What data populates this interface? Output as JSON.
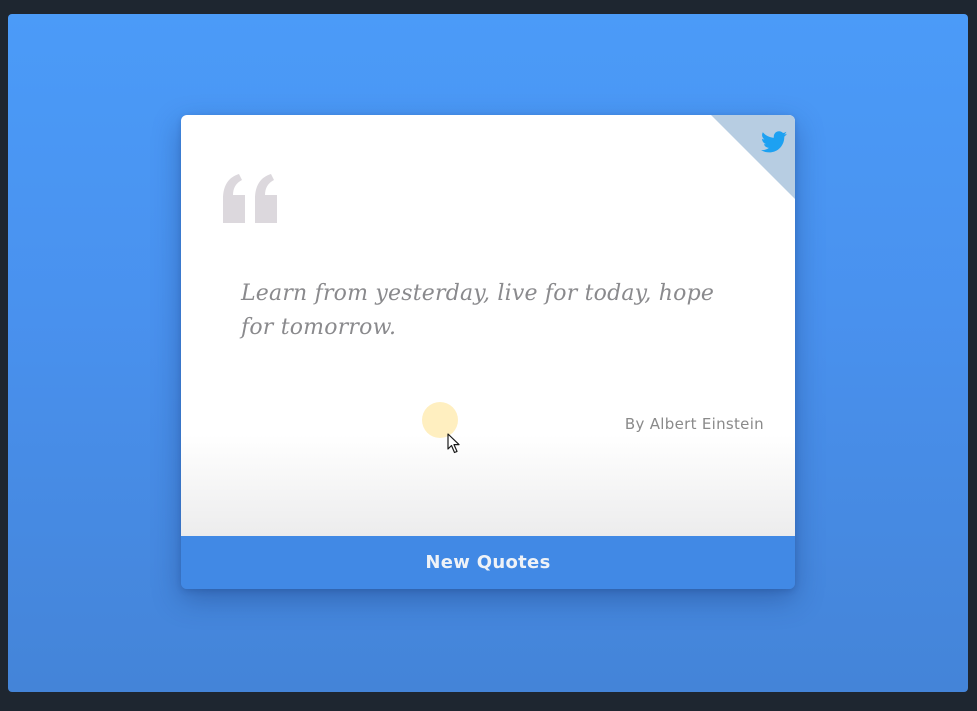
{
  "quote": {
    "text": "Learn from yesterday, live for today, hope for tomorrow.",
    "author": "By Albert Einstein"
  },
  "actions": {
    "new_quotes_label": "New Quotes"
  },
  "icons": {
    "quote": "quote-mark-icon",
    "twitter": "twitter-icon",
    "cursor": "mouse-cursor-icon"
  },
  "colors": {
    "background": "#4b9bf8",
    "card": "#ffffff",
    "button": "#4189e5",
    "button_text": "#eef2f7",
    "quote_text": "#8a8a8d",
    "twitter": "#1da1f2",
    "corner_fold": "#b7cde2"
  }
}
